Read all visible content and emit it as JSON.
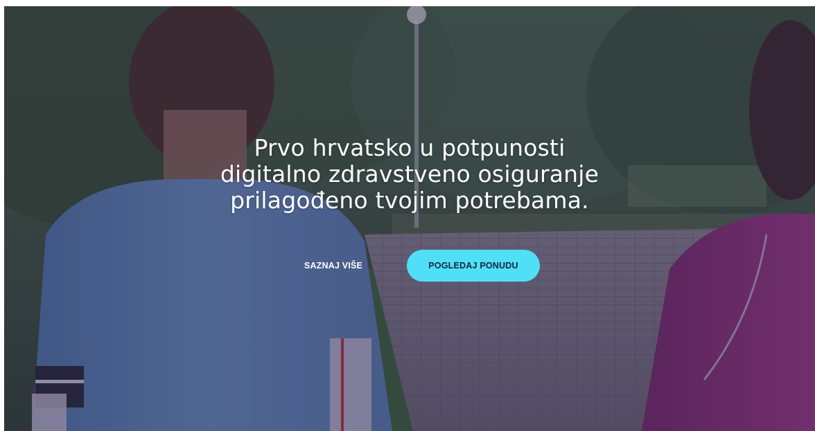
{
  "hero": {
    "headline_lines": [
      "Prvo hrvatsko u potpunosti",
      "digitalno zdravstveno osiguranje",
      "prilagođeno tvojim potrebama."
    ],
    "secondary_button_label": "SAZNAJ VIŠE",
    "primary_button_label": "POGLEDAJ PONUDU"
  },
  "colors": {
    "primary_button_bg": "#4fe0f7",
    "primary_button_text": "#15243a",
    "headline_text": "#ffffff",
    "overlay": "#281e46"
  }
}
